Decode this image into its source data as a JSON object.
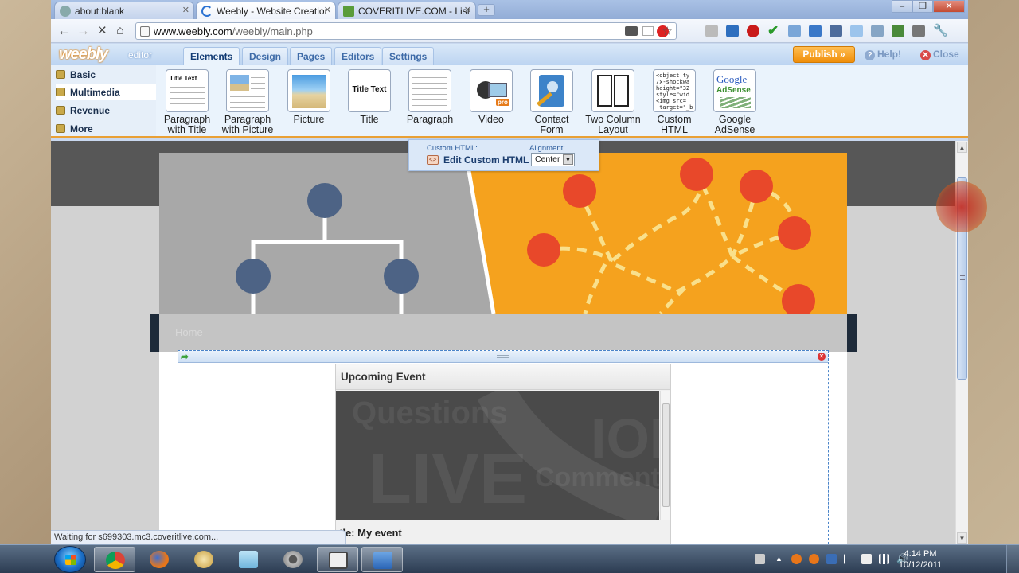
{
  "browser": {
    "tabs": [
      {
        "title": "about:blank"
      },
      {
        "title": "Weebly - Website Creation"
      },
      {
        "title": "COVERITLIVE.COM - List Li"
      }
    ],
    "url_host": "www.weebly.com",
    "url_path": "/weebly/main.php",
    "status_text": "Waiting for s699303.mc3.coveritlive.com..."
  },
  "editor": {
    "logo": "weebly",
    "logo_suffix": "editor",
    "tabs": [
      "Elements",
      "Design",
      "Pages",
      "Editors",
      "Settings"
    ],
    "active_tab": "Elements",
    "publish_label": "Publish »",
    "help_label": "Help!",
    "close_label": "Close",
    "categories": [
      "Basic",
      "Multimedia",
      "Revenue",
      "More"
    ],
    "selected_category": "Multimedia",
    "elements": [
      {
        "label_1": "Paragraph",
        "label_2": "with Title",
        "icon": "paragraph-title-icon",
        "thumb_title": "Title Text",
        "thumb_text": "It was a really s the sky. The lig through the wi"
      },
      {
        "label_1": "Paragraph",
        "label_2": "with Picture",
        "icon": "paragraph-picture-icon"
      },
      {
        "label_1": "Picture",
        "label_2": "",
        "icon": "picture-icon"
      },
      {
        "label_1": "Title",
        "label_2": "",
        "icon": "title-icon",
        "thumb_title": "Title Text"
      },
      {
        "label_1": "Paragraph",
        "label_2": "",
        "icon": "paragraph-icon"
      },
      {
        "label_1": "Video",
        "label_2": "",
        "icon": "video-camera-icon"
      },
      {
        "label_1": "Contact",
        "label_2": "Form",
        "icon": "contact-form-icon"
      },
      {
        "label_1": "Two Column",
        "label_2": "Layout",
        "icon": "two-column-icon"
      },
      {
        "label_1": "Custom",
        "label_2": "HTML",
        "icon": "custom-html-icon",
        "thumb_code": "<object ty\n/x-shockwa\nheight=\"32\nstyle=\"wid\n<img src=\n target=\"_b"
      },
      {
        "label_1": "Google",
        "label_2": "AdSense",
        "icon": "adsense-icon",
        "thumb_l1": "Google",
        "thumb_l2": "AdSense"
      }
    ]
  },
  "custom_html_popup": {
    "label": "Custom HTML:",
    "action": "Edit Custom HTML",
    "alignment_label": "Alignment:",
    "alignment_value": "Center"
  },
  "page": {
    "nav_home": "Home",
    "event_heading": "Upcoming Event",
    "event_title_partial": "tle: My event",
    "watermark": [
      "Questions",
      "LIVE",
      "Comment",
      "ION"
    ]
  },
  "taskbar": {
    "time": "4:14 PM",
    "date": "10/12/2011"
  },
  "colors": {
    "accent_orange": "#f08e0a",
    "editor_blue": "#bcd4f1",
    "banner_orange": "#f5a21e",
    "node_red": "#e8482a",
    "node_slate": "#4d6385"
  }
}
